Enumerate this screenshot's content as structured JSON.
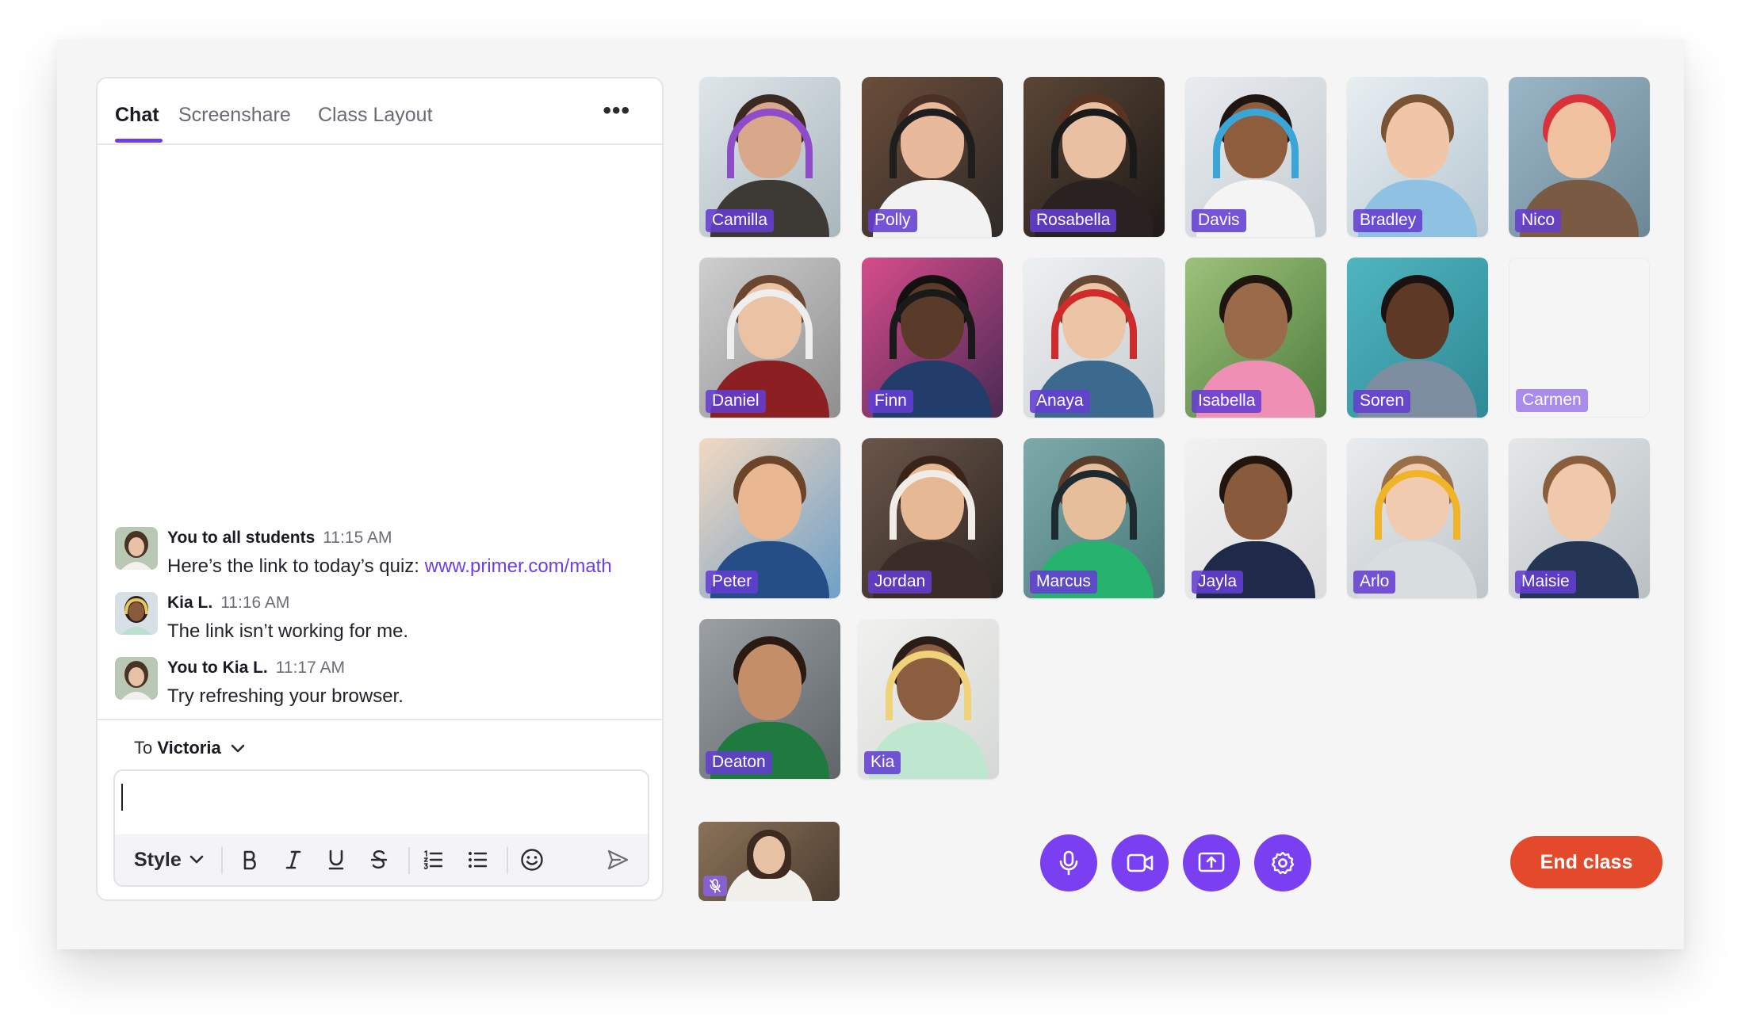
{
  "tabs": [
    {
      "label": "Chat",
      "active": true
    },
    {
      "label": "Screenshare",
      "active": false
    },
    {
      "label": "Class Layout",
      "active": false
    }
  ],
  "more_icon": "ellipsis-icon",
  "messages": [
    {
      "sender": "You to all students",
      "time": "11:15 AM",
      "text": "Here’s the link to today’s quiz: ",
      "link": "www.primer.com/math"
    },
    {
      "sender": "Kia L.",
      "time": "11:16 AM",
      "text": "The link isn’t working for me."
    },
    {
      "sender": "You to Kia L.",
      "time": "11:17 AM",
      "text": "Try refreshing your browser."
    }
  ],
  "composer": {
    "to_prefix": "To",
    "recipient": "Victoria",
    "input_value": "",
    "style_label": "Style",
    "toolbar_icons": [
      "bold-icon",
      "italic-icon",
      "underline-icon",
      "strikethrough-icon",
      "ordered-list-icon",
      "bullet-list-icon",
      "emoji-icon",
      "send-icon"
    ]
  },
  "students": [
    {
      "name": "Camilla"
    },
    {
      "name": "Polly"
    },
    {
      "name": "Rosabella"
    },
    {
      "name": "Davis"
    },
    {
      "name": "Bradley"
    },
    {
      "name": "Nico"
    },
    {
      "name": "Daniel"
    },
    {
      "name": "Finn"
    },
    {
      "name": "Anaya"
    },
    {
      "name": "Isabella"
    },
    {
      "name": "Soren"
    },
    {
      "name": "Carmen",
      "video_off": true
    },
    {
      "name": "Peter"
    },
    {
      "name": "Jordan"
    },
    {
      "name": "Marcus"
    },
    {
      "name": "Jayla"
    },
    {
      "name": "Arlo"
    },
    {
      "name": "Maisie"
    },
    {
      "name": "Deaton"
    },
    {
      "name": "Kia"
    }
  ],
  "self_view": {
    "mic_icon": "mic-off-icon"
  },
  "controls": [
    {
      "icon": "microphone-icon"
    },
    {
      "icon": "video-camera-icon"
    },
    {
      "icon": "screenshare-icon"
    },
    {
      "icon": "settings-gear-icon"
    }
  ],
  "end_class_label": "End class",
  "colors": {
    "accent": "#7a3ff0",
    "end_button": "#e34a2b",
    "name_tag": "#643ed2",
    "link": "#6d3ee6"
  }
}
